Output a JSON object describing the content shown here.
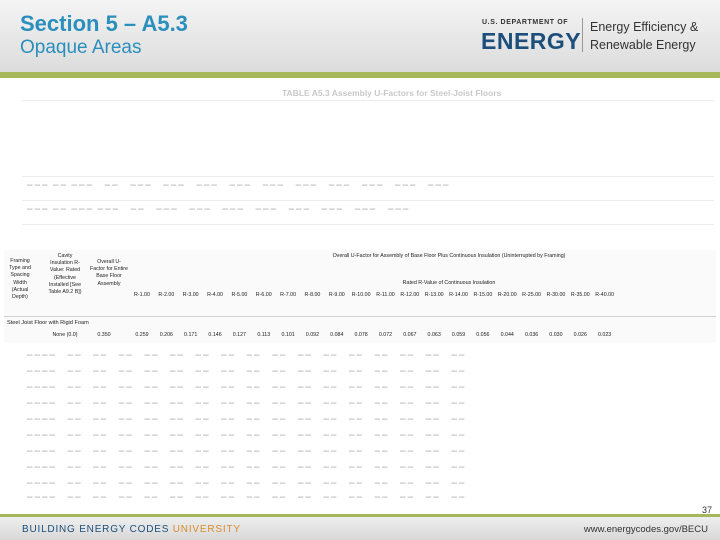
{
  "header": {
    "title": "Section 5 – A5.3",
    "subtitle": "Opaque Areas"
  },
  "logo": {
    "dept_line": "U.S. DEPARTMENT OF",
    "agency": "ENERGY",
    "program_line1": "Energy Efficiency &",
    "program_line2": "Renewable Energy"
  },
  "colors": {
    "accent": "#2a8fbd",
    "rule": "#a6b65b",
    "navy": "#1c4f7c",
    "orange": "#d98c2b"
  },
  "background_table_title": "TABLE A5.3 Assembly U-Factors for Steel-Joist Floors",
  "table": {
    "col_framing": "Framing Type and Spacing Width (Actual Depth)",
    "col_cavity": "Cavity Insulation R-Value: Rated (Effective Installed [See Table A9.2 B])",
    "col_overall": "Overall U-Factor for Entire Base Floor Assembly",
    "top_header": "Overall U-Factor for Assembly of Base Floor Plus Continuous Insulation (Uninterrupted by Framing)",
    "rated_header": "Rated R-Value of Continuous Insulation",
    "r_columns": [
      "R-1.00",
      "R-2.00",
      "R-3.00",
      "R-4.00",
      "R-5.00",
      "R-6.00",
      "R-7.00",
      "R-8.00",
      "R-9.00",
      "R-10.00",
      "R-11.00",
      "R-12.00",
      "R-13.00",
      "R-14.00",
      "R-15.00",
      "R-20.00",
      "R-25.00",
      "R-30.00",
      "R-35.00",
      "R-40.00"
    ],
    "section_label": "Steel Joist Floor with Rigid Foam",
    "row": {
      "cavity": "None (0.0)",
      "overall": "0.350",
      "values": [
        "0.259",
        "0.206",
        "0.171",
        "0.146",
        "0.127",
        "0.113",
        "0.101",
        "0.092",
        "0.084",
        "0.078",
        "0.072",
        "0.067",
        "0.063",
        "0.059",
        "0.056",
        "0.044",
        "0.036",
        "0.030",
        "0.026",
        "0.023"
      ]
    }
  },
  "page_number": "37",
  "footer": {
    "left_a": "BUILDING ENERGY CODES ",
    "left_b": "UNIVERSITY",
    "url": "www.energycodes.gov/BECU"
  }
}
